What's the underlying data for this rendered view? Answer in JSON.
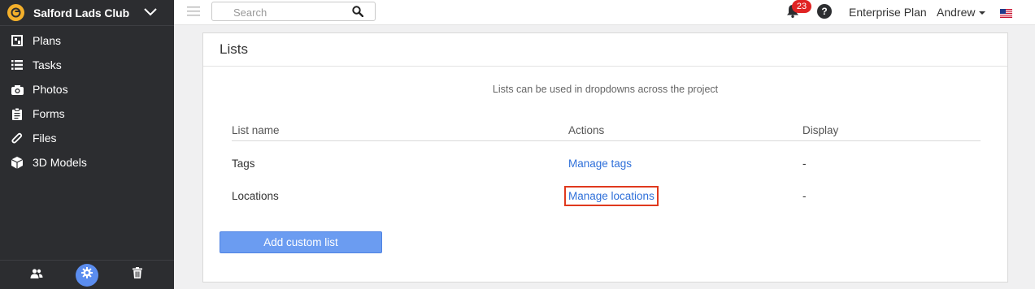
{
  "sidebar": {
    "project_name": "Salford Lads Club",
    "items": [
      {
        "label": "Plans",
        "icon": "plans-icon"
      },
      {
        "label": "Tasks",
        "icon": "tasks-icon"
      },
      {
        "label": "Photos",
        "icon": "camera-icon"
      },
      {
        "label": "Forms",
        "icon": "clipboard-icon"
      },
      {
        "label": "Files",
        "icon": "paperclip-icon"
      },
      {
        "label": "3D Models",
        "icon": "cube-icon"
      }
    ],
    "footer": [
      "people-icon",
      "gear-icon",
      "trash-icon"
    ]
  },
  "topbar": {
    "search_placeholder": "Search",
    "notification_count": "23",
    "help_label": "?",
    "plan_label": "Enterprise Plan",
    "user_name": "Andrew",
    "flag": "us-flag-icon"
  },
  "panel": {
    "title": "Lists",
    "description": "Lists can be used in dropdowns across the project",
    "columns": [
      "List name",
      "Actions",
      "Display"
    ],
    "rows": [
      {
        "name": "Tags",
        "action": "Manage tags",
        "display": "-"
      },
      {
        "name": "Locations",
        "action": "Manage locations",
        "display": "-"
      }
    ],
    "add_button": "Add custom list"
  },
  "colors": {
    "sidebar_bg": "#2c2d30",
    "accent": "#5b8def",
    "link": "#2e6fd9",
    "badge": "#e02424",
    "highlight": "#e0391d"
  }
}
